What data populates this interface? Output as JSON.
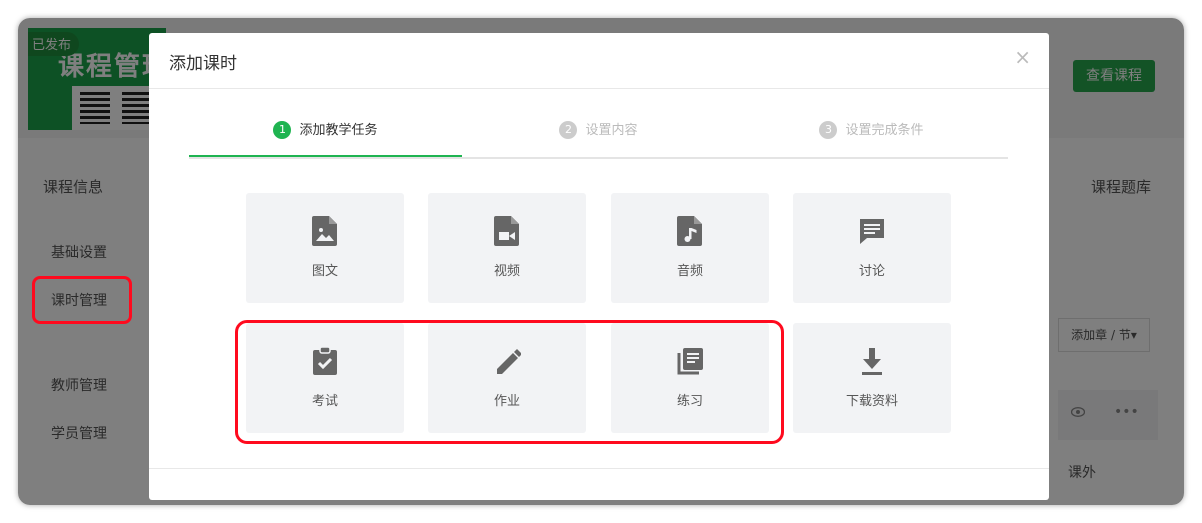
{
  "background": {
    "badge": "已发布",
    "cover_title": "课程管理",
    "view_course_button": "查看课程",
    "left_section_title": "课程信息",
    "right_section_title": "课程题库",
    "left_nav": [
      "基础设置",
      "课时管理",
      "教师管理",
      "学员管理"
    ],
    "add_chapter_button": "添加章 / 节▾",
    "row_out_label": "课外",
    "eye_icon": "eye-icon",
    "more_icon": "more-icon"
  },
  "modal": {
    "title": "添加课时",
    "close": "×",
    "steps": [
      {
        "num": "1",
        "label": "添加教学任务",
        "active": true
      },
      {
        "num": "2",
        "label": "设置内容",
        "active": false
      },
      {
        "num": "3",
        "label": "设置完成条件",
        "active": false
      }
    ],
    "tiles": [
      {
        "label": "图文",
        "icon": "image-file-icon"
      },
      {
        "label": "视频",
        "icon": "video-file-icon"
      },
      {
        "label": "音频",
        "icon": "audio-file-icon"
      },
      {
        "label": "讨论",
        "icon": "discussion-icon"
      },
      {
        "label": "考试",
        "icon": "exam-clipboard-icon"
      },
      {
        "label": "作业",
        "icon": "pencil-icon"
      },
      {
        "label": "练习",
        "icon": "library-icon"
      },
      {
        "label": "下载资料",
        "icon": "download-icon"
      }
    ]
  },
  "colors": {
    "accent_green": "#1fb451",
    "highlight_red": "#ff0a1e",
    "icon_gray": "#666666"
  }
}
